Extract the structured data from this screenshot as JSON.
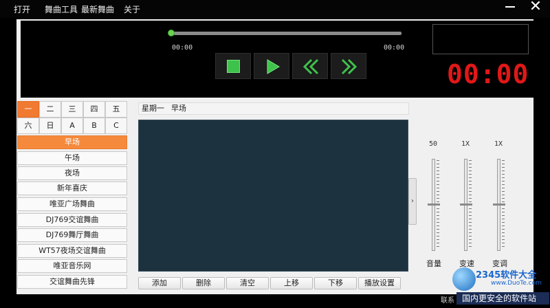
{
  "menu": {
    "open": "打开",
    "dance_tools": "舞曲工具",
    "latest_dance": "最新舞曲",
    "about": "关于"
  },
  "player": {
    "time_start": "00:00",
    "time_end": "00:00",
    "clock": "00:00",
    "progress": 0.0,
    "accent_color": "#3fc24c",
    "clock_color": "#e01818"
  },
  "days": [
    "一",
    "二",
    "三",
    "四",
    "五",
    "六",
    "日",
    "A",
    "B",
    "C"
  ],
  "scenes": [
    "早场",
    "午场",
    "夜场",
    "新年喜庆",
    "唯亚广场舞曲",
    "DJ769交谊舞曲",
    "DJ769舞厅舞曲",
    "WT57夜场交谊舞曲",
    "唯亚音乐网",
    "交谊舞曲先锋"
  ],
  "playlist_header": {
    "day": "星期一",
    "scene": "早场"
  },
  "actions": {
    "add": "添加",
    "delete": "删除",
    "clear": "清空",
    "move_up": "上移",
    "move_down": "下移",
    "play_settings": "播放设置"
  },
  "sliders": {
    "volume": {
      "value": "50",
      "label": "音量"
    },
    "speed": {
      "value": "1X",
      "label": "变速"
    },
    "pitch": {
      "value": "1X",
      "label": "变调"
    }
  },
  "footer": {
    "contact": "联系"
  },
  "watermark": {
    "brand": "2345软件大全",
    "url": "www.DuoTe.com",
    "tagline": "国内更安全的软件站"
  }
}
